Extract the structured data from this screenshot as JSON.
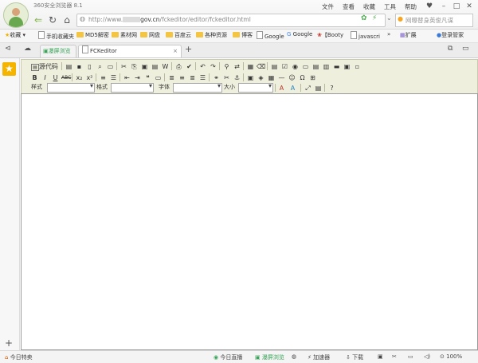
{
  "app": {
    "title": "360安全浏览器 8.1",
    "menus": [
      "文件",
      "查看",
      "收藏",
      "工具",
      "帮助"
    ]
  },
  "address": {
    "url_prefix": "http://www.",
    "url_domain": "gov.cn",
    "url_path": "/fckeditor/editor/fckeditor.html",
    "search_placeholder": "网曝替身英俊凡谋"
  },
  "bookmarks": {
    "favorites_label": "收藏",
    "items": [
      "手机收藏夹",
      "MD5解密",
      "素材网",
      "网盘",
      "百度云",
      "各种资源",
      "博客",
      "Google",
      "Google",
      "【Booty",
      "javascri"
    ],
    "extensions_label": "扩展",
    "login_label": "登录管家"
  },
  "tabs": {
    "items": [
      {
        "label": "瀑屏浏览"
      },
      {
        "label": "FCKeditor"
      }
    ]
  },
  "editor": {
    "source_label": "源代码",
    "style_label": "样式",
    "format_label": "格式",
    "font_label": "字体",
    "size_label": "大小",
    "style_value": "",
    "format_value": "",
    "font_value": "",
    "size_value": ""
  },
  "status": {
    "news": "今日特卖",
    "live": "今日直播",
    "split_view": "瀑屏浏览",
    "accelerator": "加速器",
    "download": "下载",
    "zoom": "100%"
  }
}
